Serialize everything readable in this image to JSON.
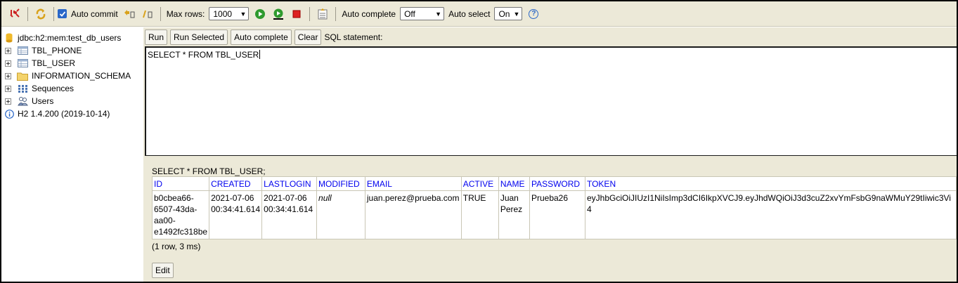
{
  "toolbar": {
    "auto_commit_label": "Auto commit",
    "max_rows_label": "Max rows:",
    "max_rows_value": "1000",
    "auto_complete_label": "Auto complete",
    "auto_complete_value": "Off",
    "auto_select_label": "Auto select",
    "auto_select_value": "On",
    "help_glyph": "?",
    "colors": {
      "run_green": "#2e9a2e",
      "stop_red": "#d22",
      "help_blue": "#2a67c8"
    }
  },
  "tree": {
    "connection": "jdbc:h2:mem:test_db_users",
    "items": [
      {
        "label": "TBL_PHONE",
        "icon": "table-icon"
      },
      {
        "label": "TBL_USER",
        "icon": "table-icon"
      },
      {
        "label": "INFORMATION_SCHEMA",
        "icon": "folder-icon"
      },
      {
        "label": "Sequences",
        "icon": "sequences-icon"
      },
      {
        "label": "Users",
        "icon": "users-icon"
      }
    ],
    "version": "H2 1.4.200 (2019-10-14)"
  },
  "query": {
    "run_label": "Run",
    "run_selected_label": "Run Selected",
    "auto_complete_label": "Auto complete",
    "clear_label": "Clear",
    "sql_statement_label": "SQL statement:",
    "editor_text": "SELECT * FROM TBL_USER"
  },
  "results": {
    "statement": "SELECT * FROM TBL_USER;",
    "columns": [
      "ID",
      "CREATED",
      "LASTLOGIN",
      "MODIFIED",
      "EMAIL",
      "ACTIVE",
      "NAME",
      "PASSWORD",
      "TOKEN"
    ],
    "row": {
      "id": [
        "b0cbea66-",
        "6507-43da-",
        "aa00-",
        "e1492fc318be"
      ],
      "created": [
        "2021-07-06",
        "00:34:41.614"
      ],
      "lastlogin": [
        "2021-07-06",
        "00:34:41.614"
      ],
      "modified": "null",
      "email": "juan.perez@prueba.com",
      "active": "TRUE",
      "name": [
        "Juan",
        "Perez"
      ],
      "password": "Prueba26",
      "token": [
        "eyJhbGciOiJIUzI1NiIsImp3dCI6IkpXVCJ9.eyJhdWQiOiJ3d3cuZ2xvYmFsbG9naWMuY29tIiwic3Vi",
        "4"
      ]
    },
    "summary": "(1 row, 3 ms)",
    "edit_label": "Edit"
  }
}
